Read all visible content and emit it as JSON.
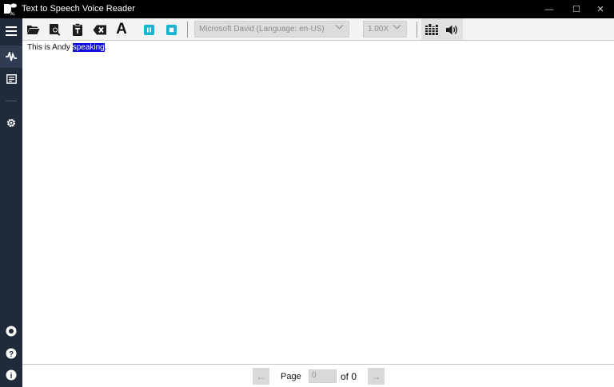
{
  "window": {
    "title": "Text to Speech Voice Reader",
    "minimize_glyph": "—",
    "maximize_glyph": "☐",
    "close_glyph": "✕"
  },
  "sidebar": {
    "items": [
      {
        "icon": "hamburger-menu-icon"
      },
      {
        "icon": "waveform-icon",
        "active": true
      },
      {
        "icon": "document-list-icon"
      },
      {
        "icon": "gear-icon"
      },
      {
        "icon": "record-icon"
      },
      {
        "icon": "help-icon"
      },
      {
        "icon": "info-icon"
      }
    ]
  },
  "toolbar": {
    "font_label": "A",
    "voice": {
      "selected": "Microsoft David (Language: en-US)"
    },
    "speed": {
      "selected": "1.00X"
    },
    "accent_color": "#1ab3d1",
    "icons": [
      "open-folder-icon",
      "search-file-icon",
      "paste-text-icon",
      "clear-icon",
      "font-icon",
      "pause-icon",
      "stop-icon",
      "voice-dropdown-chevron-icon",
      "speed-dropdown-chevron-icon",
      "equalizer-icon",
      "speaker-icon"
    ]
  },
  "content": {
    "text_before": "This is Andy ",
    "text_highlight": "speaking",
    "text_after": ".",
    "highlight_color": "#0a0adf"
  },
  "pagination": {
    "prev_glyph": "←",
    "next_glyph": "→",
    "page_label": "Page",
    "page_value": "0",
    "of_label": "of 0"
  }
}
